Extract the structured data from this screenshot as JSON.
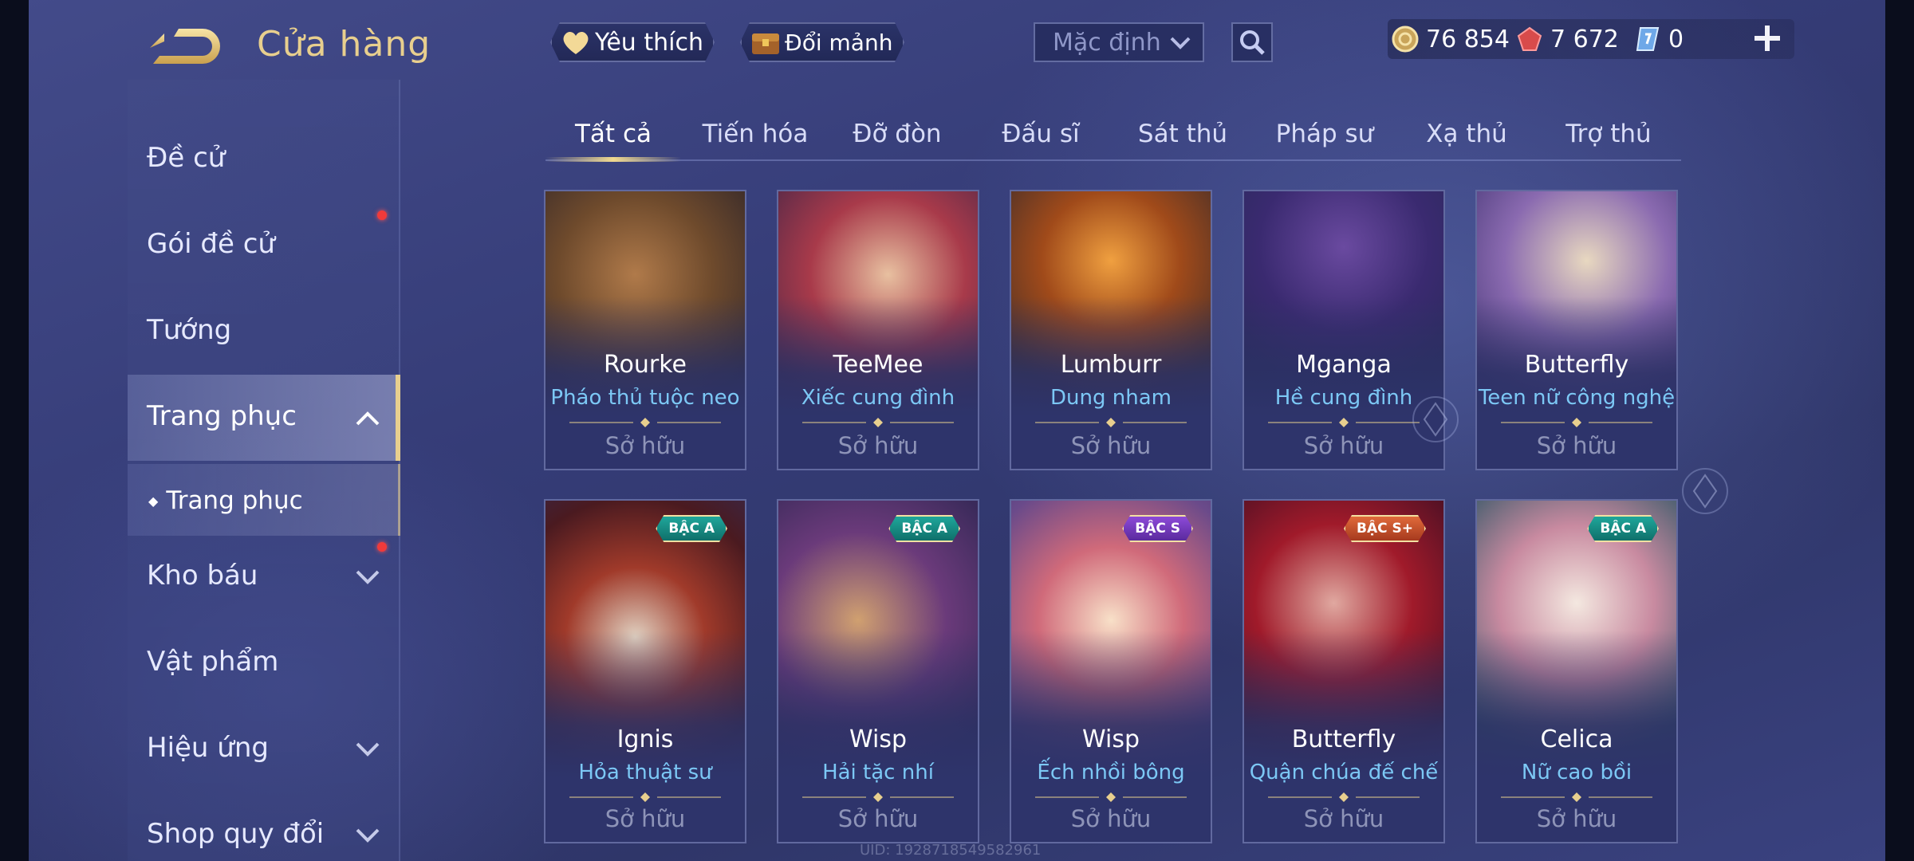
{
  "header": {
    "title": "Cửa hàng",
    "favorite_label": "Yêu thích",
    "shard_exchange_label": "Đổi mảnh",
    "sort_value": "Mặc định",
    "currency": {
      "gold": "76 854",
      "ruby": "7 672",
      "voucher": "0"
    }
  },
  "sidebar": {
    "items": [
      {
        "label": "Đề cử"
      },
      {
        "label": "Gói đề cử"
      },
      {
        "label": "Tướng"
      },
      {
        "label": "Trang phục"
      },
      {
        "label": "Trang phục"
      },
      {
        "label": "Kho báu"
      },
      {
        "label": "Vật phẩm"
      },
      {
        "label": "Hiệu ứng"
      },
      {
        "label": "Shop quy đổi"
      }
    ]
  },
  "tabs": [
    {
      "label": "Tất cả"
    },
    {
      "label": "Tiến hóa"
    },
    {
      "label": "Đỡ đòn"
    },
    {
      "label": "Đấu sĩ"
    },
    {
      "label": "Sát thủ"
    },
    {
      "label": "Pháp sư"
    },
    {
      "label": "Xạ thủ"
    },
    {
      "label": "Trợ thủ"
    }
  ],
  "skins": [
    {
      "hero": "Rourke",
      "skin": "Pháo thủ tuộc neo",
      "status": "Sở hữu",
      "tier": ""
    },
    {
      "hero": "TeeMee",
      "skin": "Xiếc cung đình",
      "status": "Sở hữu",
      "tier": ""
    },
    {
      "hero": "Lumburr",
      "skin": "Dung nham",
      "status": "Sở hữu",
      "tier": ""
    },
    {
      "hero": "Mganga",
      "skin": "Hề cung đình",
      "status": "Sở hữu",
      "tier": ""
    },
    {
      "hero": "Butterfly",
      "skin": "Teen nữ công nghệ",
      "status": "Sở hữu",
      "tier": ""
    },
    {
      "hero": "Ignis",
      "skin": "Hỏa thuật sư",
      "status": "Sở hữu",
      "tier": "BẬC A"
    },
    {
      "hero": "Wisp",
      "skin": "Hải tặc nhí",
      "status": "Sở hữu",
      "tier": "BẬC A"
    },
    {
      "hero": "Wisp",
      "skin": "Ếch nhồi bông",
      "status": "Sở hữu",
      "tier": "BẬC S"
    },
    {
      "hero": "Butterfly",
      "skin": "Quận chúa đế chế",
      "status": "Sở hữu",
      "tier": "BẬC S+"
    },
    {
      "hero": "Celica",
      "skin": "Nữ cao bồi",
      "status": "Sở hữu",
      "tier": "BẬC A"
    }
  ],
  "footer": {
    "uid": "UID: 1928718549582961"
  },
  "colors": {
    "accent_gold": "#e8cf8e",
    "skin_name_blue": "#7cc8f5",
    "notification_red": "#f03a3a"
  }
}
